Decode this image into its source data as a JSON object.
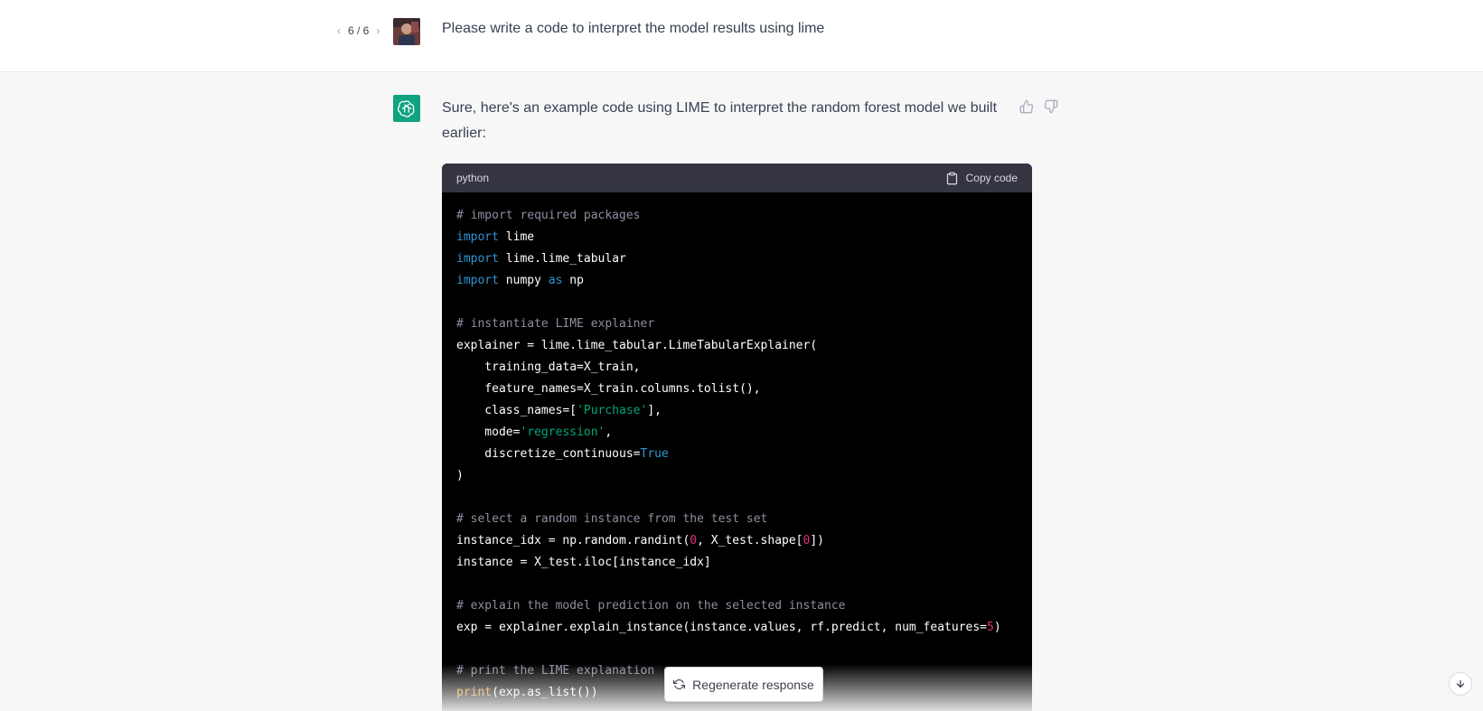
{
  "user_message": {
    "pager": {
      "prev_icon": "chevron-left-icon",
      "count": "6 / 6",
      "next_icon": "chevron-right-icon"
    },
    "text": "Please write a code to interpret the model results using lime"
  },
  "assistant_message": {
    "text": "Sure, here's an example code using LIME to interpret the random forest model we built earlier:",
    "avatar_icon": "openai-logo-icon",
    "avatar_color": "#10a37f"
  },
  "code_block": {
    "language": "python",
    "copy_label": "Copy code",
    "lines": [
      "# import required packages",
      "import lime",
      "import lime.lime_tabular",
      "import numpy as np",
      "",
      "# instantiate LIME explainer",
      "explainer = lime.lime_tabular.LimeTabularExplainer(",
      "    training_data=X_train,",
      "    feature_names=X_train.columns.tolist(),",
      "    class_names=['Purchase'],",
      "    mode='regression',",
      "    discretize_continuous=True",
      ")",
      "",
      "# select a random instance from the test set",
      "instance_idx = np.random.randint(0, X_test.shape[0])",
      "instance = X_test.iloc[instance_idx]",
      "",
      "# explain the model prediction on the selected instance",
      "exp = explainer.explain_instance(instance.values, rf.predict, num_features=5)",
      "",
      "# print the LIME explanation",
      "print(exp.as_list())"
    ]
  },
  "actions": {
    "regenerate_label": "Regenerate response",
    "thumbs_up_icon": "thumbs-up-icon",
    "thumbs_down_icon": "thumbs-down-icon",
    "scroll_down_icon": "arrow-down-icon"
  },
  "colors": {
    "accent": "#10a37f",
    "code_background": "#000000",
    "code_header": "#343541",
    "keyword": "#2e95d3",
    "string": "#00a67d",
    "number": "#df3079",
    "comment": "#8e8ea0",
    "builtin": "#e9950c"
  }
}
